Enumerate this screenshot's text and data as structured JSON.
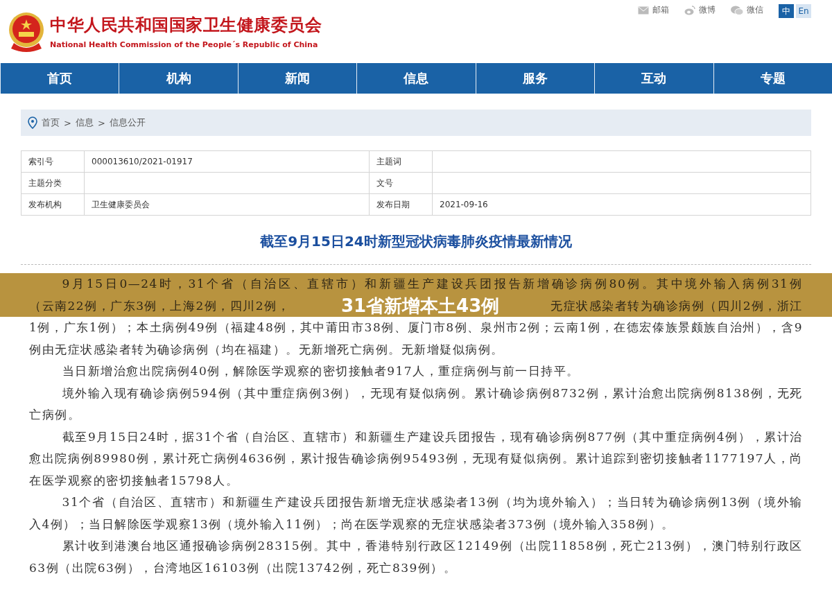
{
  "header": {
    "title": "中华人民共和国国家卫生健康委员会",
    "subtitle": "National Health Commission of the People´s Republic of China",
    "links": [
      {
        "label": "邮箱",
        "kind": "mail"
      },
      {
        "label": "微博",
        "kind": "weibo"
      },
      {
        "label": "微信",
        "kind": "wechat"
      }
    ],
    "languages": [
      {
        "label": "中",
        "selected": true
      },
      {
        "label": "En",
        "selected": false
      }
    ]
  },
  "nav": [
    "首页",
    "机构",
    "新闻",
    "信息",
    "服务",
    "互动",
    "专题"
  ],
  "breadcrumb": {
    "separator": ">",
    "items": [
      "首页",
      "信息",
      "信息公开"
    ]
  },
  "meta": [
    [
      {
        "label": "索引号",
        "value": "000013610/2021-01917"
      },
      {
        "label": "主题词"
      }
    ],
    [
      {
        "label": "主题分类"
      },
      {
        "label": "文号"
      }
    ],
    [
      {
        "label": "发布机构",
        "value": "卫生健康委员会"
      },
      {
        "label": "发布日期",
        "value": "2021-09-16"
      }
    ]
  ],
  "article": {
    "title": "截至9月15日24时新型冠状病毒肺炎疫情最新情况",
    "paragraphs": [
      {
        "kind": "captioned",
        "segments": [
          "9月15日0—24时，31个省（自治区、直辖市）和新疆生产建设兵团报告新增确诊病例80例。其中境外输入病例31例",
          "（云南22例，广东3例，上海2例，四川2例，",
          "无症状感染者转为确诊病例（四川2例，浙江",
          "1例，广东1例）；本土病例49例（福建48例，其中莆田市38例、厦门市8例、泉州市2例；云南1例，在德宏傣族景颇族自治州），含9例由无症状感染者转为确诊病例（均在福建）。无新增死亡病例。无新增疑似病例。"
        ]
      },
      {
        "kind": "plain",
        "text": "当日新增治愈出院病例40例，解除医学观察的密切接触者917人，重症病例与前一日持平。"
      },
      {
        "kind": "plain",
        "text": "境外输入现有确诊病例594例（其中重症病例3例），无现有疑似病例。累计确诊病例8732例，累计治愈出院病例8138例，无死亡病例。"
      },
      {
        "kind": "plain",
        "text": "截至9月15日24时，据31个省（自治区、直辖市）和新疆生产建设兵团报告，现有确诊病例877例（其中重症病例4例），累计治愈出院病例89980例，累计死亡病例4636例，累计报告确诊病例95493例，无现有疑似病例。累计追踪到密切接触者1177197人，尚在医学观察的密切接触者15798人。"
      },
      {
        "kind": "plain",
        "text": "31个省（自治区、直辖市）和新疆生产建设兵团报告新增无症状感染者13例（均为境外输入）；当日转为确诊病例13例（境外输入4例）；当日解除医学观察13例（境外输入11例）；尚在医学观察的无症状感染者373例（境外输入358例）。"
      },
      {
        "kind": "plain",
        "text": "累计收到港澳台地区通报确诊病例28315例。其中，香港特别行政区12149例（出院11858例，死亡213例），澳门特别行政区63例（出院63例），台湾地区16103例（出院13742例，死亡839例）。"
      }
    ]
  },
  "overlay": {
    "text": "31省新增本土43例"
  }
}
